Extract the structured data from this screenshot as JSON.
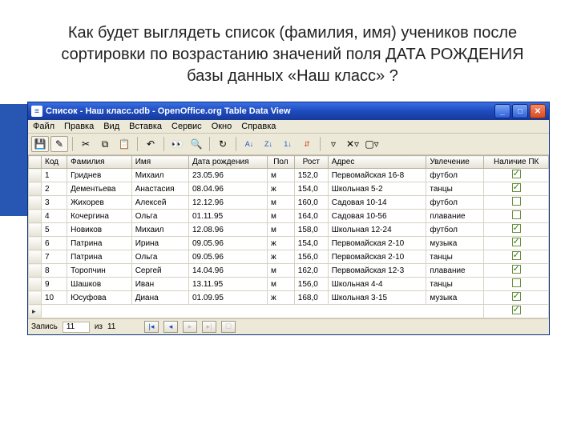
{
  "question": "Как будет выглядеть список (фамилия, имя) учеников после сортировки по возрастанию значений поля ДАТА РОЖДЕНИЯ базы данных «Наш класс» ?",
  "window": {
    "title": "Список - Наш класс.odb - OpenOffice.org Table Data View"
  },
  "menu": {
    "file": "Файл",
    "edit": "Правка",
    "view": "Вид",
    "insert": "Вставка",
    "tools": "Сервис",
    "window": "Окно",
    "help": "Справка"
  },
  "columns": {
    "id": "Код",
    "surname": "Фамилия",
    "name": "Имя",
    "dob": "Дата рождения",
    "sex": "Пол",
    "height": "Рост",
    "address": "Адрес",
    "hobby": "Увлечение",
    "pc": "Наличие ПК"
  },
  "rows": [
    {
      "id": "1",
      "surname": "Гриднев",
      "name": "Михаил",
      "dob": "23.05.96",
      "sex": "м",
      "height": "152,0",
      "address": "Первомайская 16-8",
      "hobby": "футбол",
      "pc": true
    },
    {
      "id": "2",
      "surname": "Дементьева",
      "name": "Анастасия",
      "dob": "08.04.96",
      "sex": "ж",
      "height": "154,0",
      "address": "Школьная 5-2",
      "hobby": "танцы",
      "pc": true
    },
    {
      "id": "3",
      "surname": "Жихорев",
      "name": "Алексей",
      "dob": "12.12.96",
      "sex": "м",
      "height": "160,0",
      "address": "Садовая 10-14",
      "hobby": "футбол",
      "pc": false
    },
    {
      "id": "4",
      "surname": "Кочергина",
      "name": "Ольга",
      "dob": "01.11.95",
      "sex": "м",
      "height": "164,0",
      "address": "Садовая 10-56",
      "hobby": "плавание",
      "pc": false
    },
    {
      "id": "5",
      "surname": "Новиков",
      "name": "Михаил",
      "dob": "12.08.96",
      "sex": "м",
      "height": "158,0",
      "address": "Школьная 12-24",
      "hobby": "футбол",
      "pc": true
    },
    {
      "id": "6",
      "surname": "Патрина",
      "name": "Ирина",
      "dob": "09.05.96",
      "sex": "ж",
      "height": "154,0",
      "address": "Первомайская 2-10",
      "hobby": "музыка",
      "pc": true
    },
    {
      "id": "7",
      "surname": "Патрина",
      "name": "Ольга",
      "dob": "09.05.96",
      "sex": "ж",
      "height": "156,0",
      "address": "Первомайская 2-10",
      "hobby": "танцы",
      "pc": true
    },
    {
      "id": "8",
      "surname": "Торопчин",
      "name": "Сергей",
      "dob": "14.04.96",
      "sex": "м",
      "height": "162,0",
      "address": "Первомайская 12-3",
      "hobby": "плавание",
      "pc": true
    },
    {
      "id": "9",
      "surname": "Шашков",
      "name": "Иван",
      "dob": "13.11.95",
      "sex": "м",
      "height": "156,0",
      "address": "Школьная 4-4",
      "hobby": "танцы",
      "pc": false
    },
    {
      "id": "10",
      "surname": "Юсуфова",
      "name": "Диана",
      "dob": "01.09.95",
      "sex": "ж",
      "height": "168,0",
      "address": "Школьная 3-15",
      "hobby": "музыка",
      "pc": true
    }
  ],
  "status": {
    "record_label": "Запись",
    "current": "11",
    "of_label": "из",
    "total": "11"
  },
  "icons": {
    "save": "💾",
    "edit": "✎",
    "cut": "✂",
    "copy": "⧉",
    "paste": "📋",
    "undo": "↶",
    "find": "🔍",
    "binoc": "👀",
    "refresh": "↻",
    "sort_az": "A↓",
    "sort_za": "Z↓",
    "sort_num": "1↓",
    "sort_custom": "⇵",
    "filter": "▿",
    "filter2": "✕▿",
    "filter3": "▢▿"
  }
}
